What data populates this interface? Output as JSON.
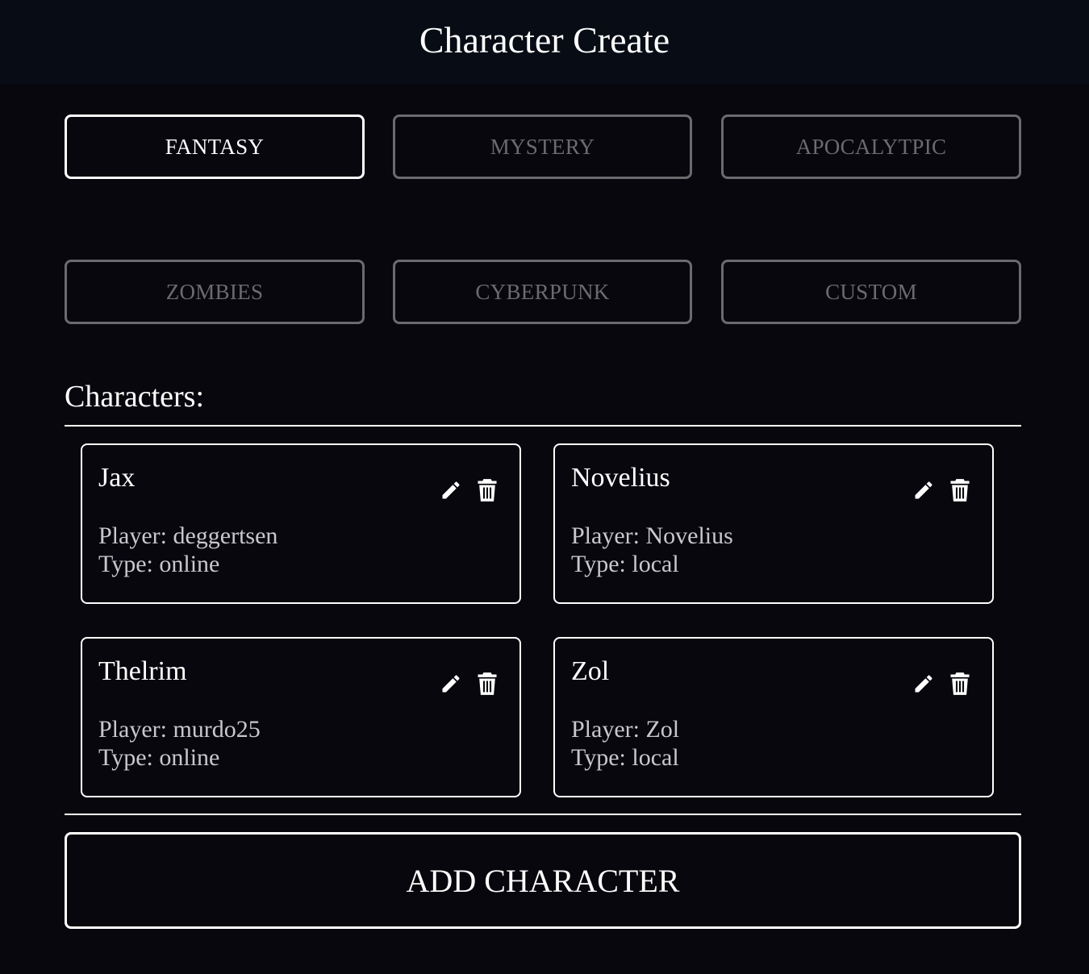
{
  "header": {
    "title": "Character Create"
  },
  "genres": [
    {
      "label": "FANTASY",
      "active": true
    },
    {
      "label": "MYSTERY",
      "active": false
    },
    {
      "label": "APOCALYTPIC",
      "active": false
    },
    {
      "label": "ZOMBIES",
      "active": false
    },
    {
      "label": "CYBERPUNK",
      "active": false
    },
    {
      "label": "CUSTOM",
      "active": false
    }
  ],
  "characters_section": {
    "label": "Characters:"
  },
  "characters": [
    {
      "name": "Jax",
      "player": "Player: deggertsen",
      "type": "Type: online"
    },
    {
      "name": "Novelius",
      "player": "Player: Novelius",
      "type": "Type: local"
    },
    {
      "name": "Thelrim",
      "player": "Player: murdo25",
      "type": "Type: online"
    },
    {
      "name": "Zol",
      "player": "Player: Zol",
      "type": "Type: local"
    }
  ],
  "actions": {
    "add_character_label": "ADD CHARACTER"
  },
  "icons": {
    "edit": "pencil-icon",
    "delete": "trash-icon"
  },
  "colors": {
    "background": "#08070e",
    "header_background": "#080c15",
    "active_border": "#ffffff",
    "inactive_border": "#6b6b6e",
    "muted_text": "#c8c8cc"
  }
}
